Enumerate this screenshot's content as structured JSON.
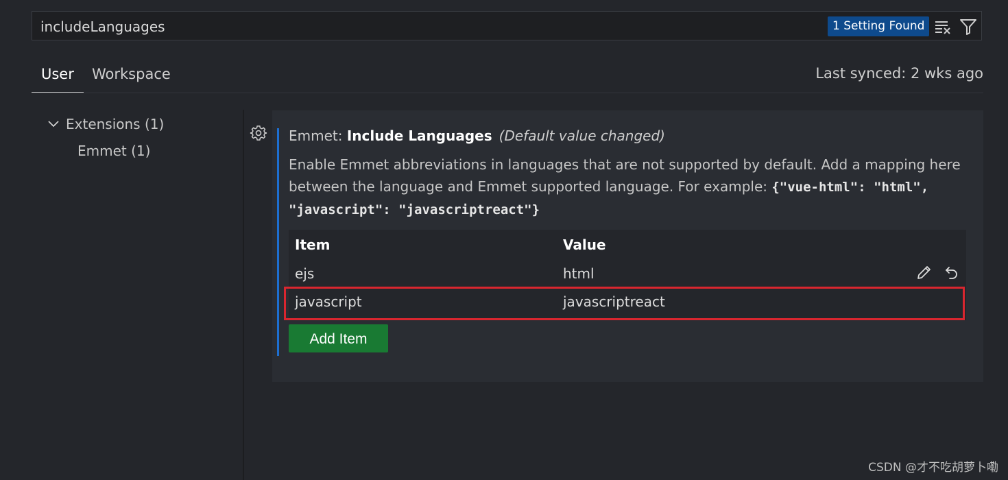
{
  "search": {
    "value": "includeLanguages",
    "result_badge": "1 Setting Found",
    "icons": [
      "clear-filter-icon",
      "filter-icon"
    ]
  },
  "tabs": [
    {
      "label": "User",
      "active": true
    },
    {
      "label": "Workspace",
      "active": false
    }
  ],
  "sync_status": "Last synced: 2 wks ago",
  "toc": {
    "extensions_label": "Extensions (1)",
    "emmet_label": "Emmet (1)"
  },
  "setting": {
    "category": "Emmet: ",
    "name": "Include Languages",
    "modified": "(Default value changed)",
    "description_text": "Enable Emmet abbreviations in languages that are not supported by default. Add a mapping here between the language and Emmet supported language. For example: ",
    "description_code": "{\"vue-html\": \"html\", \"javascript\": \"javascriptreact\"}",
    "table": {
      "header_item": "Item",
      "header_value": "Value",
      "rows": [
        {
          "item": "ejs",
          "value": "html"
        },
        {
          "item": "javascript",
          "value": "javascriptreact"
        }
      ]
    },
    "add_item_label": "Add Item"
  },
  "watermark": "CSDN @才不吃胡萝卜嘞",
  "colors": {
    "background": "#24262b",
    "badge": "#0e4a8c",
    "focus_bar": "#1d6fd1",
    "highlight": "#d9262f",
    "add_button": "#197a33"
  }
}
